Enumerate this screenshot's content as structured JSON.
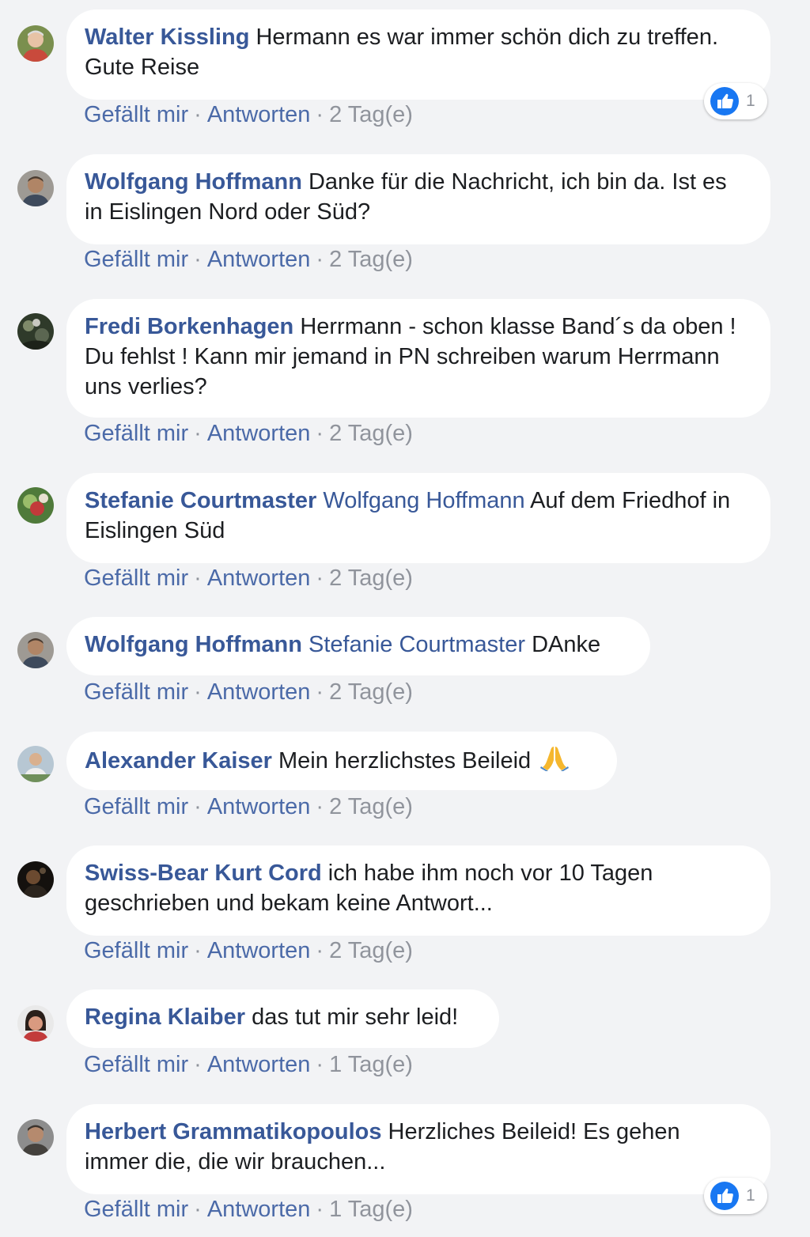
{
  "action_labels": {
    "like": "Gefällt mir",
    "reply": "Antworten",
    "separator": "·"
  },
  "comments": [
    {
      "author": "Walter Kissling",
      "text": "Hermann es war immer schön dich zu treffen. Gute Reise",
      "time": "2 Tag(e)",
      "likes": "1"
    },
    {
      "author": "Wolfgang Hoffmann",
      "text": "Danke für die Nachricht, ich bin da. Ist es in Eislingen Nord oder Süd?",
      "time": "2 Tag(e)"
    },
    {
      "author": "Fredi Borkenhagen",
      "text": "Herrmann - schon klasse Band´s da oben ! Du fehlst ! Kann mir jemand in PN schreiben warum Herrmann uns verlies?",
      "time": "2 Tag(e)"
    },
    {
      "author": "Stefanie Courtmaster",
      "mention": "Wolfgang Hoffmann",
      "text": "Auf dem Friedhof in Eislingen Süd",
      "time": "2 Tag(e)"
    },
    {
      "author": "Wolfgang Hoffmann",
      "mention": "Stefanie Courtmaster",
      "text": "DAnke",
      "time": "2 Tag(e)"
    },
    {
      "author": "Alexander Kaiser",
      "text": "Mein herzlichstes Beileid",
      "emoji": "folded-hands-icon",
      "time": "2 Tag(e)"
    },
    {
      "author": "Swiss-Bear Kurt Cord",
      "text": "ich habe ihm noch vor 10 Tagen geschrieben und bekam keine Antwort...",
      "time": "2 Tag(e)"
    },
    {
      "author": "Regina Klaiber",
      "text": "das tut mir sehr leid!",
      "time": "1 Tag(e)"
    },
    {
      "author": "Herbert Grammatikopoulos",
      "text": "Herzliches Beileid! Es gehen immer die, die wir brauchen...",
      "time": "1 Tag(e)",
      "likes": "1"
    }
  ],
  "colors": {
    "page_background": "#f2f3f5",
    "bubble_background": "#ffffff",
    "author_link": "#385898",
    "action_link": "#4b6aa8",
    "meta_text": "#90949c",
    "like_badge": "#1877f2"
  }
}
